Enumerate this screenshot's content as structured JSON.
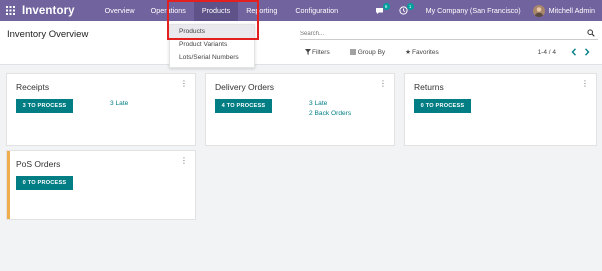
{
  "navbar": {
    "app_name": "Inventory",
    "menu": [
      "Overview",
      "Operations",
      "Products",
      "Reporting",
      "Configuration"
    ],
    "messages_badge": "6",
    "activities_badge": "1",
    "company": "My Company (San Francisco)",
    "user": "Mitchell Admin"
  },
  "control": {
    "title": "Inventory Overview",
    "search_placeholder": "Search...",
    "filters_label": "Filters",
    "groupby_label": "Group By",
    "favorites_label": "Favorites",
    "pager_value": "1-4 / 4"
  },
  "dropdown": {
    "items": [
      "Products",
      "Product Variants",
      "Lots/Serial Numbers"
    ]
  },
  "cards": [
    {
      "title": "Receipts",
      "button": "3 TO PROCESS",
      "links": [
        "3 Late"
      ]
    },
    {
      "title": "Delivery Orders",
      "button": "4 TO PROCESS",
      "links": [
        "3 Late",
        "2 Back Orders"
      ]
    },
    {
      "title": "Returns",
      "button": "0 TO PROCESS",
      "links": []
    },
    {
      "title": "PoS Orders",
      "button": "0 TO PROCESS",
      "links": []
    }
  ],
  "colors": {
    "navbar": "#71639e",
    "primary_button": "#017e84",
    "highlight": "#e1201f",
    "pos_accent": "#f0ad4e"
  }
}
